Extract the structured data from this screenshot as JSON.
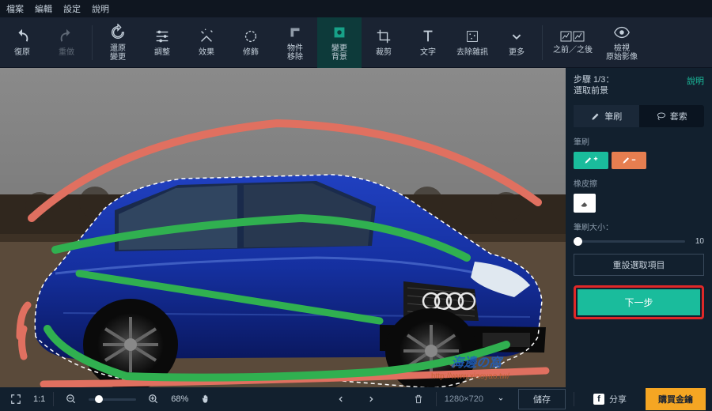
{
  "menu": {
    "file": "檔案",
    "edit": "編輯",
    "settings": "設定",
    "help": "說明"
  },
  "toolbar": {
    "undo": "復原",
    "redo": "重做",
    "revert": "還原\n變更",
    "adjust": "調整",
    "effects": "效果",
    "retouch": "修飾",
    "removeObj": "物件\n移除",
    "changeBg": "變更\n背景",
    "crop": "裁剪",
    "text": "文字",
    "denoise": "去除雜訊",
    "more": "更多",
    "beforeAfter": "之前／之後",
    "viewOrig": "檢視\n原始影像"
  },
  "panel": {
    "stepLine1": "步驟 1/3：",
    "stepLine2": "選取前景",
    "help": "說明",
    "tabBrush": "筆刷",
    "tabLasso": "套索",
    "brushLabel": "筆刷",
    "eraserLabel": "橡皮擦",
    "sizeLabel": "筆刷大小：",
    "sizeValue": "10",
    "reset": "重設選取項目",
    "next": "下一步"
  },
  "status": {
    "ratio": "1:1",
    "zoom": "68%",
    "dims": "1280×720",
    "save": "儲存",
    "share": "分享",
    "buy": "購買金鑰"
  },
  "watermark": {
    "text1": "海邊の窩",
    "text2": "http://www.xiaoyao.tw/"
  }
}
